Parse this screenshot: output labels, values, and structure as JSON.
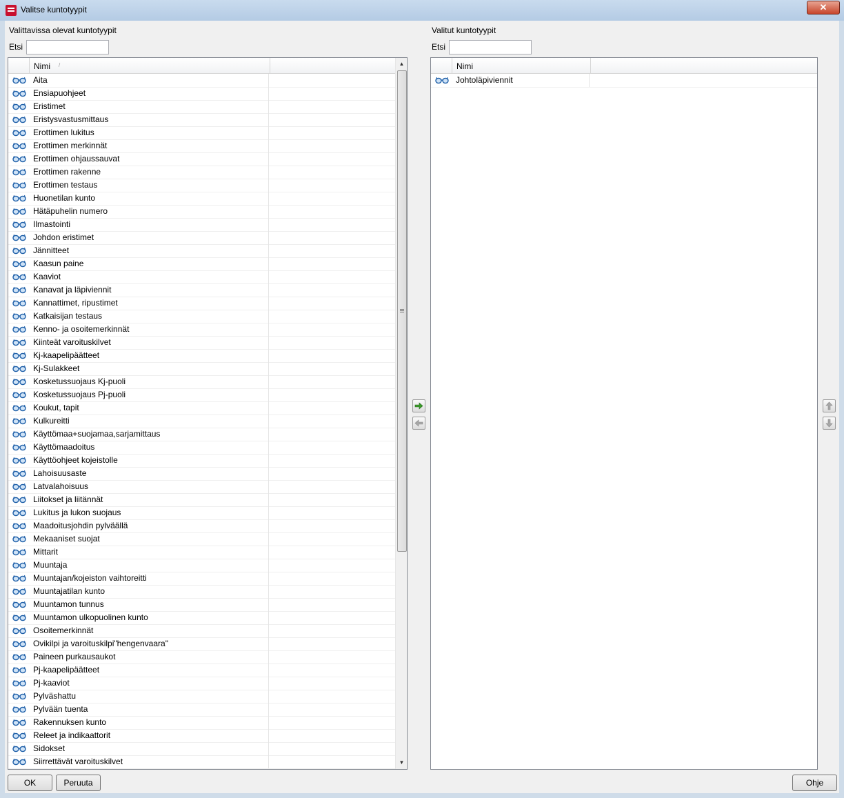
{
  "window": {
    "title": "Valitse kuntotyypit"
  },
  "left": {
    "heading": "Valittavissa olevat kuntotyypit",
    "search_label": "Etsi",
    "search_value": "",
    "column_name": "Nimi",
    "items": [
      "Aita",
      "Ensiapuohjeet",
      "Eristimet",
      "Eristysvastusmittaus",
      "Erottimen lukitus",
      "Erottimen merkinnät",
      "Erottimen ohjaussauvat",
      "Erottimen rakenne",
      "Erottimen testaus",
      "Huonetilan kunto",
      "Hätäpuhelin numero",
      "Ilmastointi",
      "Johdon eristimet",
      "Jännitteet",
      "Kaasun paine",
      "Kaaviot",
      "Kanavat ja läpiviennit",
      "Kannattimet, ripustimet",
      "Katkaisijan testaus",
      "Kenno- ja osoitemerkinnät",
      "Kiinteät varoituskilvet",
      "Kj-kaapelipäätteet",
      "Kj-Sulakkeet",
      "Kosketussuojaus Kj-puoli",
      "Kosketussuojaus Pj-puoli",
      "Koukut, tapit",
      "Kulkureitti",
      "Käyttömaa+suojamaa,sarjamittaus",
      "Käyttömaadoitus",
      "Käyttöohjeet kojeistolle",
      "Lahoisuusaste",
      "Latvalahoisuus",
      "Liitokset ja liitännät",
      "Lukitus ja lukon suojaus",
      "Maadoitusjohdin pylväällä",
      "Mekaaniset suojat",
      "Mittarit",
      "Muuntaja",
      "Muuntajan/kojeiston vaihtoreitti",
      "Muuntajatilan kunto",
      "Muuntamon tunnus",
      "Muuntamon ulkopuolinen kunto",
      "Osoitemerkinnät",
      "Ovikilpi ja varoituskilpi\"hengenvaara\"",
      "Paineen purkausaukot",
      "Pj-kaapelipäätteet",
      "Pj-kaaviot",
      "Pylväshattu",
      "Pylvään tuenta",
      "Rakennuksen kunto",
      "Releet ja indikaattorit",
      "Sidokset",
      "Siirrettävät varoituskilvet"
    ]
  },
  "right": {
    "heading": "Valitut kuntotyypit",
    "search_label": "Etsi",
    "search_value": "",
    "column_name": "Nimi",
    "items": [
      "Johtoläpiviennit"
    ]
  },
  "buttons": {
    "ok": "OK",
    "cancel": "Peruuta",
    "help": "Ohje"
  },
  "icons": {
    "row_icon": "glasses-icon",
    "add": "arrow-right-icon",
    "remove": "arrow-left-icon",
    "move_up": "arrow-up-icon",
    "move_down": "arrow-down-icon"
  },
  "colors": {
    "glasses": "#1e5fa8",
    "add_arrow": "#3a9a2a"
  }
}
